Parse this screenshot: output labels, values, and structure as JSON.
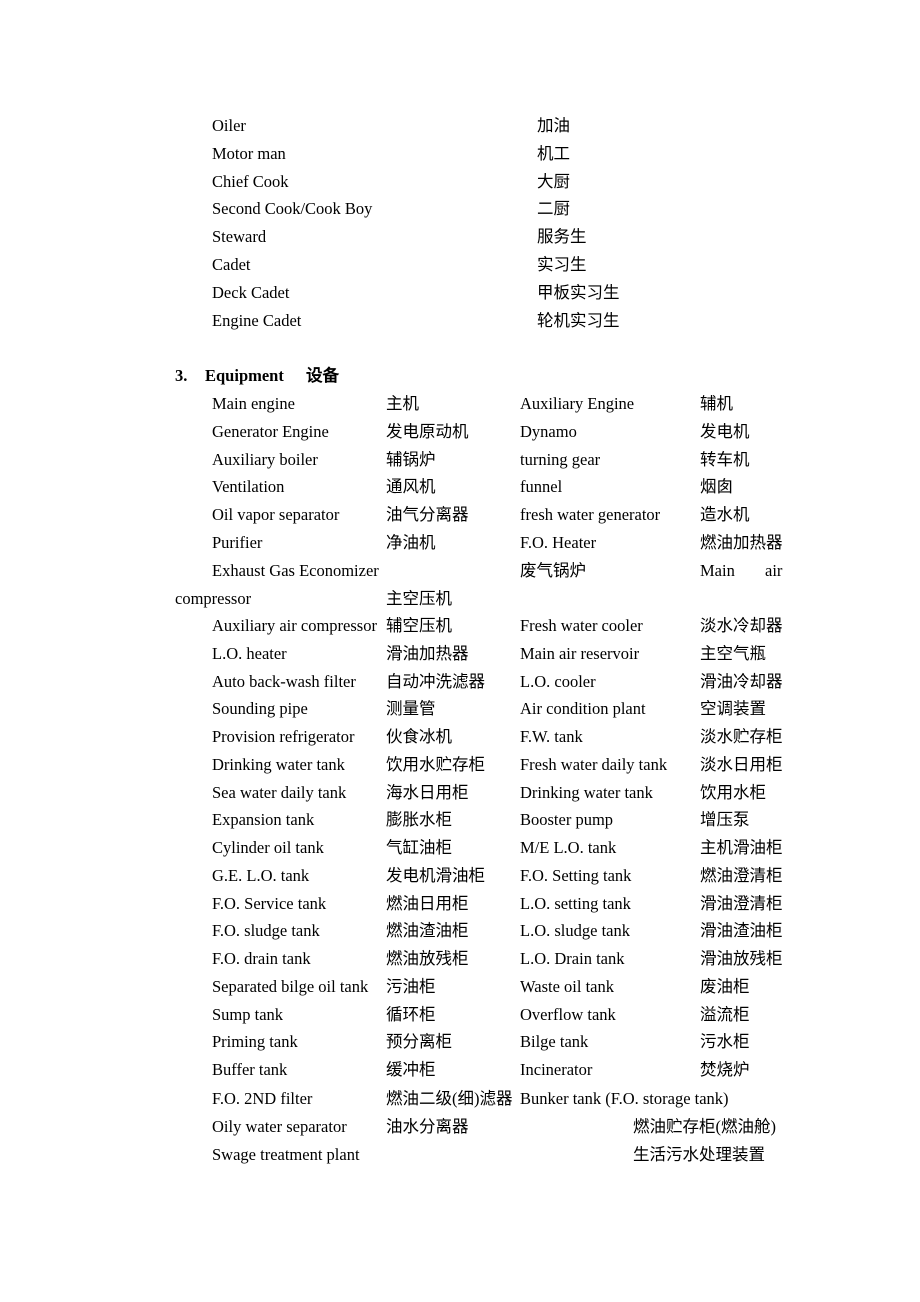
{
  "crew_list": [
    {
      "en": "Oiler",
      "zh": "加油"
    },
    {
      "en": "Motor man",
      "zh": "机工"
    },
    {
      "en": "Chief Cook",
      "zh": "大厨"
    },
    {
      "en": "Second Cook/Cook Boy",
      "zh": "二厨"
    },
    {
      "en": "Steward",
      "zh": "服务生"
    },
    {
      "en": "Cadet",
      "zh": "实习生"
    },
    {
      "en": "Deck Cadet",
      "zh": "甲板实习生"
    },
    {
      "en": "Engine Cadet",
      "zh": "轮机实习生"
    }
  ],
  "section": {
    "number": "3.",
    "title_en": "Equipment",
    "title_zh": "设备"
  },
  "equipment_rows": [
    {
      "en1": "Main engine",
      "zh1": "主机",
      "en2": "Auxiliary Engine",
      "zh2": "辅机"
    },
    {
      "en1": "Generator Engine",
      "zh1": "发电原动机",
      "en2": "Dynamo",
      "zh2": "发电机"
    },
    {
      "en1": "Auxiliary boiler",
      "zh1": "辅锅炉",
      "en2": "turning gear",
      "zh2": "转车机"
    },
    {
      "en1": "Ventilation",
      "zh1": "通风机",
      "en2": "funnel",
      "zh2": "烟囱"
    },
    {
      "en1": "Oil vapor separator",
      "zh1": "油气分离器",
      "en2": "fresh water generator",
      "zh2": "造水机"
    },
    {
      "en1": "Purifier",
      "zh1": "净油机",
      "en2": "F.O. Heater",
      "zh2": "燃油加热器"
    }
  ],
  "wrapped_row": {
    "en1": "Exhaust Gas Economizer",
    "zh1": "废气锅炉",
    "en2_part1": "Main",
    "en2_part2": "air",
    "en2_cont": "compressor",
    "zh2": "主空压机"
  },
  "equipment_rows_2": [
    {
      "en1": "Auxiliary air compressor",
      "zh1": "辅空压机",
      "en2": "Fresh water cooler",
      "zh2": "淡水冷却器"
    },
    {
      "en1": "L.O. heater",
      "zh1": "滑油加热器",
      "en2": "Main air reservoir",
      "zh2": "主空气瓶"
    },
    {
      "en1": "Auto back-wash filter",
      "zh1": "自动冲洗滤器",
      "en2": "L.O. cooler",
      "zh2": "滑油冷却器"
    },
    {
      "en1": "Sounding pipe",
      "zh1": "测量管",
      "en2": "Air condition plant",
      "zh2": "空调装置"
    },
    {
      "en1": "Provision refrigerator",
      "zh1": "伙食冰机",
      "en2": "F.W. tank",
      "zh2": "淡水贮存柜"
    },
    {
      "en1": "Drinking water tank",
      "zh1": "饮用水贮存柜",
      "en2": "Fresh water daily tank",
      "zh2": "淡水日用柜"
    },
    {
      "en1": "Sea water daily tank",
      "zh1": "海水日用柜",
      "en2": "Drinking water tank",
      "zh2": "饮用水柜"
    },
    {
      "en1": "Expansion tank",
      "zh1": "膨胀水柜",
      "en2": "Booster pump",
      "zh2": "增压泵"
    },
    {
      "en1": "Cylinder oil tank",
      "zh1": "气缸油柜",
      "en2": "M/E L.O. tank",
      "zh2": "主机滑油柜"
    },
    {
      "en1": "G.E. L.O. tank",
      "zh1": "发电机滑油柜",
      "en2": "F.O. Setting tank",
      "zh2": "燃油澄清柜"
    },
    {
      "en1": "F.O. Service tank",
      "zh1": "燃油日用柜",
      "en2": "L.O. setting tank",
      "zh2": "滑油澄清柜"
    },
    {
      "en1": "F.O. sludge tank",
      "zh1": "燃油渣油柜",
      "en2": "L.O. sludge tank",
      "zh2": "滑油渣油柜"
    },
    {
      "en1": "F.O. drain tank",
      "zh1": "燃油放残柜",
      "en2": "L.O. Drain tank",
      "zh2": "滑油放残柜"
    },
    {
      "en1": "Separated bilge oil tank",
      "zh1": "污油柜",
      "en2": "Waste oil tank",
      "zh2": "废油柜"
    },
    {
      "en1": "Sump tank",
      "zh1": "循环柜",
      "en2": "Overflow tank",
      "zh2": "溢流柜"
    },
    {
      "en1": "Priming tank",
      "zh1": "预分离柜",
      "en2": "Bilge tank",
      "zh2": "污水柜"
    },
    {
      "en1": "Buffer tank",
      "zh1": "缓冲柜",
      "en2": "Incinerator",
      "zh2": "焚烧炉"
    }
  ],
  "tail_rows": {
    "r1_en1": "F.O. 2ND filter",
    "r1_zh1": "燃油二级(细)滤器",
    "r1_en2": "Bunker tank (F.O. storage tank)",
    "r2_en1": "Oily water separator",
    "r2_zh1": "油水分离器",
    "r2_zh2": "燃油贮存柜(燃油舱)",
    "r3_en1": "Swage treatment plant",
    "r3_zh2": "生活污水处理装置"
  }
}
